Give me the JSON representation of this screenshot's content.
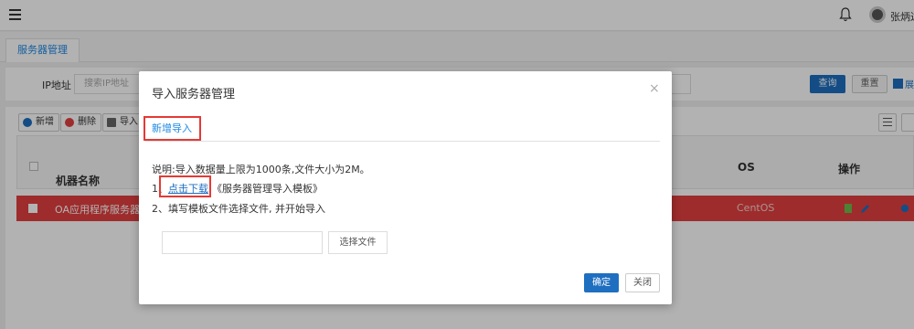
{
  "header": {
    "icons": [
      "menu-icon",
      "bell-icon",
      "avatar"
    ],
    "user_name": "张炳达"
  },
  "tabs": [
    {
      "label": "服务器管理"
    }
  ],
  "search": {
    "ip_label": "IP地址",
    "ip_placeholder": "搜索IP地址",
    "query_label": "查询",
    "reset_label": "重置",
    "expand_label": "展开"
  },
  "toolbar": {
    "add_label": "新增",
    "delete_label": "删除",
    "import_label": "导入"
  },
  "table": {
    "columns": {
      "name": "机器名称",
      "os": "OS",
      "actions": "操作"
    },
    "rows": [
      {
        "name": "OA应用程序服务器",
        "os": "CentOS"
      }
    ]
  },
  "modal": {
    "title": "导入服务器管理",
    "tab_label": "新增导入",
    "description": "说明:导入数据量上限为1000条,文件大小为2M。",
    "step1_prefix": "1、",
    "download_link": "点击下载",
    "template_name": "《服务器管理导入模板》",
    "step2": "2、填写模板文件选择文件, 并开始导入",
    "file_value": "",
    "choose_file_label": "选择文件",
    "ok_label": "确定",
    "close_label": "关闭"
  },
  "colors": {
    "accent": "#1e6fc0",
    "highlight_row": "#e2403f",
    "annotation_red": "#e53935"
  }
}
